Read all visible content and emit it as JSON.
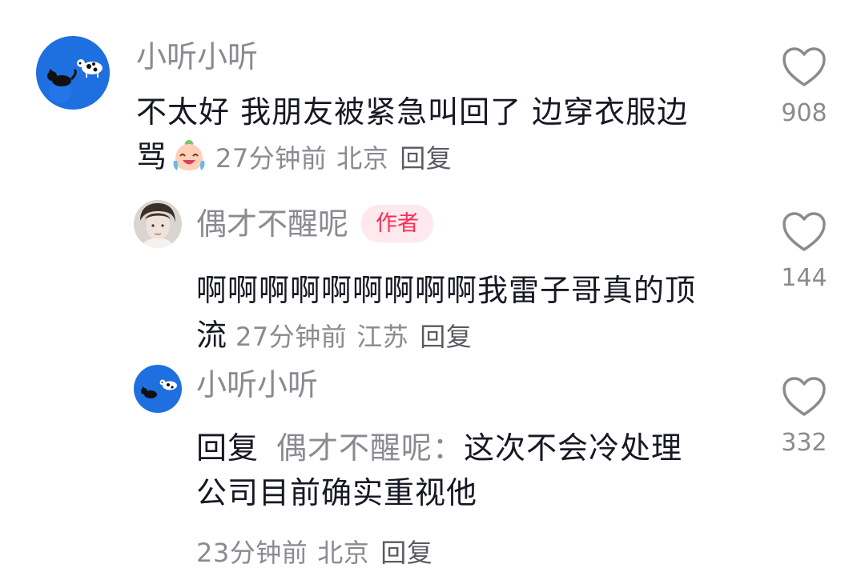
{
  "comments": [
    {
      "username": "小听小听",
      "text_line1": "不太好 我朋友被紧急叫回了 边穿衣服边",
      "text_line2": "骂",
      "time": "27分钟前",
      "location": "北京",
      "reply_label": "回复",
      "likes": "908",
      "emoji_icon": "crying-laughing-emoji-icon"
    },
    {
      "username": "偶才不醒呢",
      "badge": "作者",
      "text_line1": "啊啊啊啊啊啊啊啊啊我雷子哥真的顶",
      "text_line2": "流",
      "time": "27分钟前",
      "location": "江苏",
      "reply_label": "回复",
      "likes": "144"
    },
    {
      "username": "小听小听",
      "reply_prefix": "回复",
      "reply_target": "偶才不醒呢：",
      "text_line1_rest": "这次不会冷处理",
      "text_line2": "公司目前确实重视他",
      "time": "23分钟前",
      "location": "北京",
      "reply_label": "回复",
      "likes": "332"
    }
  ],
  "colors": {
    "text": "#161823",
    "secondary": "#8a8b91",
    "author_badge_text": "#fe2c55",
    "author_badge_bg": "#fde9ee",
    "avatar_blue": "#1f6fe0"
  },
  "icons": {
    "like": "heart-outline-icon"
  }
}
